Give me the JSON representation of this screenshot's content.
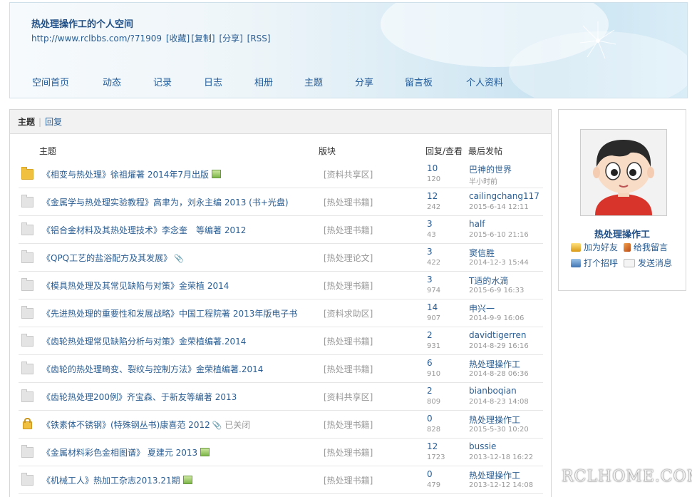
{
  "header": {
    "title": "热处理操作工的个人空间",
    "url": "http://www.rclbbs.com/?71909",
    "actions": [
      "[收藏]",
      "[复制]",
      "[分享]",
      "[RSS]"
    ]
  },
  "nav": [
    "空间首页",
    "动态",
    "记录",
    "日志",
    "相册",
    "主题",
    "分享",
    "留言板",
    "个人资料"
  ],
  "tabs": {
    "active": "主题",
    "other": "回复"
  },
  "columns": {
    "subject": "主题",
    "forum": "版块",
    "replies_views": "回复/查看",
    "last_post": "最后发帖"
  },
  "rows": [
    {
      "icon": "folder-new",
      "title": "《相变与热处理》徐祖燿著 2014年7月出版",
      "extra": "",
      "img": true,
      "clip": false,
      "forum": "[资料共享区]",
      "replies": "10",
      "views": "120",
      "user": "巴神的世界",
      "time": "半小时前"
    },
    {
      "icon": "folder",
      "title": "《金属学与热处理实验教程》高聿为，刘永主编 2013 (书+光盘)",
      "extra": "",
      "img": false,
      "clip": false,
      "forum": "[热处理书籍]",
      "replies": "12",
      "views": "242",
      "user": "cailingchang117",
      "time": "2015-6-14 12:11"
    },
    {
      "icon": "folder",
      "title": "《铝合金材料及其热处理技术》李念奎　等编著 2012",
      "extra": "",
      "img": false,
      "clip": false,
      "forum": "[热处理书籍]",
      "replies": "3",
      "views": "43",
      "user": "half",
      "time": "2015-6-10 21:16"
    },
    {
      "icon": "folder",
      "title": "《QPQ工艺的盐浴配方及其发展》",
      "extra": "",
      "img": false,
      "clip": true,
      "forum": "[热处理论文]",
      "replies": "3",
      "views": "422",
      "user": "窦信胜",
      "time": "2014-12-3 15:44"
    },
    {
      "icon": "folder",
      "title": "《模具热处理及其常见缺陷与对策》金荣植 2014",
      "extra": "",
      "img": false,
      "clip": false,
      "forum": "[热处理书籍]",
      "replies": "3",
      "views": "974",
      "user": "T适的水滴",
      "time": "2015-6-9 16:33"
    },
    {
      "icon": "folder",
      "title": "《先进热处理的重要性和发展战略》中国工程院著 2013年版电子书",
      "extra": "",
      "img": false,
      "clip": false,
      "forum": "[资料求助区]",
      "replies": "14",
      "views": "907",
      "user": "申兴一",
      "time": "2014-9-9 16:06"
    },
    {
      "icon": "folder",
      "title": "《齿轮热处理常见缺陷分析与对策》金荣植编著.2014",
      "extra": "",
      "img": false,
      "clip": false,
      "forum": "[热处理书籍]",
      "replies": "2",
      "views": "931",
      "user": "davidtigerren",
      "time": "2014-8-29 16:16"
    },
    {
      "icon": "folder",
      "title": "《齿轮的热处理畸变、裂纹与控制方法》金荣植编著.2014",
      "extra": "",
      "img": false,
      "clip": false,
      "forum": "[热处理书籍]",
      "replies": "6",
      "views": "910",
      "user": "热处理操作工",
      "time": "2014-8-28 06:36"
    },
    {
      "icon": "folder",
      "title": "《齿轮热处理200例》齐宝森、于新友等编著 2013",
      "extra": "",
      "img": false,
      "clip": false,
      "forum": "[资料共享区]",
      "replies": "2",
      "views": "809",
      "user": "bianboqian",
      "time": "2014-8-23 14:08"
    },
    {
      "icon": "lock",
      "title": "《铁素体不锈钢》(特殊钢丛书)康喜范 2012",
      "extra": "已关闭",
      "img": false,
      "clip": true,
      "forum": "[热处理书籍]",
      "replies": "0",
      "views": "828",
      "user": "热处理操作工",
      "time": "2015-5-30 10:20"
    },
    {
      "icon": "folder",
      "title": "《金属材料彩色金相图谱》 夏建元 2013",
      "extra": "",
      "img": true,
      "clip": false,
      "forum": "[热处理书籍]",
      "replies": "12",
      "views": "1723",
      "user": "bussie",
      "time": "2013-12-18 16:22"
    },
    {
      "icon": "folder",
      "title": "《机械工人》热加工杂志2013.21期",
      "extra": "",
      "img": true,
      "clip": false,
      "forum": "[热处理书籍]",
      "replies": "0",
      "views": "479",
      "user": "热处理操作工",
      "time": "2013-12-12 14:08"
    }
  ],
  "profile": {
    "name": "热处理操作工",
    "add_friend": "加为好友",
    "leave_message": "给我留言",
    "greet": "打个招呼",
    "send_message": "发送消息"
  },
  "watermark": "RCLHOME.COM"
}
